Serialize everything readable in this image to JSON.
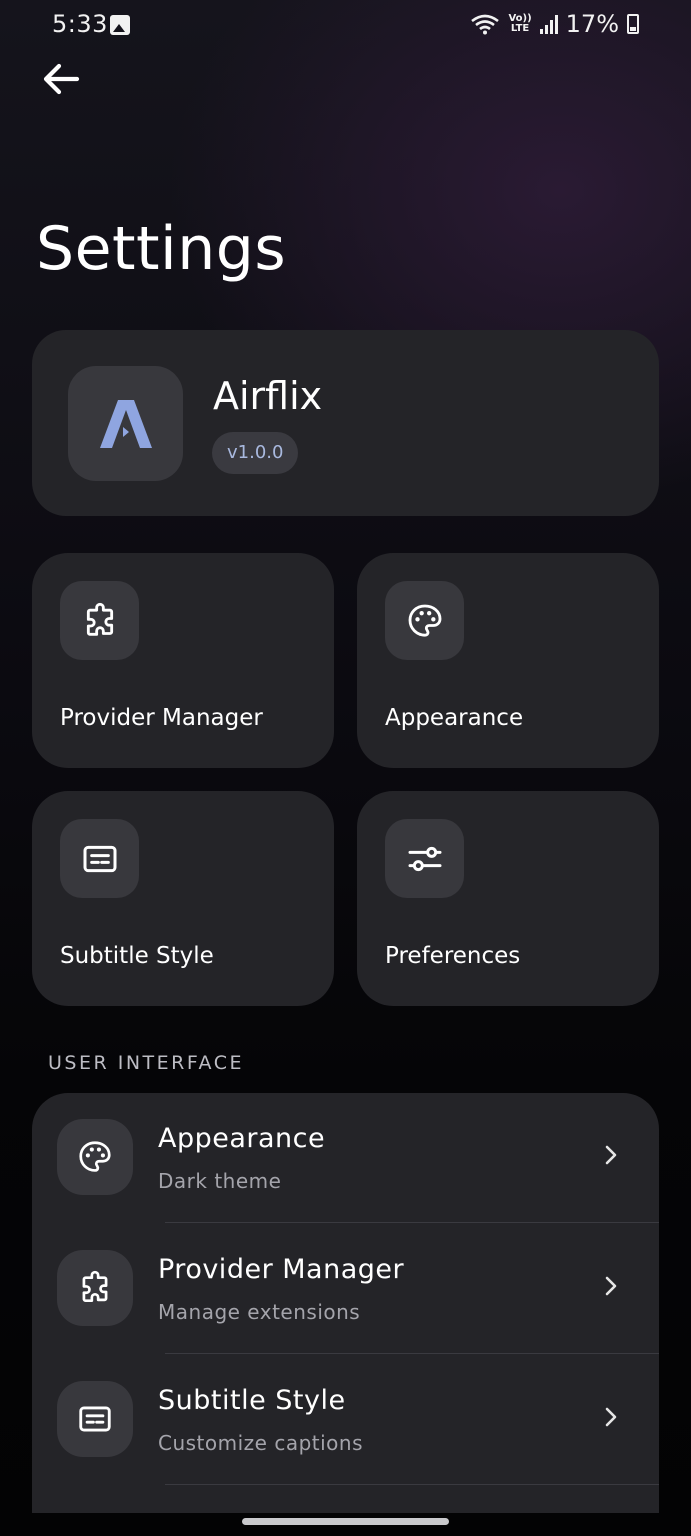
{
  "status_bar": {
    "time": "5:33",
    "volte_top": "Vo))",
    "volte_bottom": "LTE",
    "battery": "17%"
  },
  "header": {
    "title": "Settings"
  },
  "app_card": {
    "name": "Airflix",
    "version": "v1.0.0",
    "logo_letter": "A"
  },
  "tiles": [
    {
      "label": "Provider Manager",
      "icon": "puzzle-icon"
    },
    {
      "label": "Appearance",
      "icon": "palette-icon"
    },
    {
      "label": "Subtitle Style",
      "icon": "subtitles-icon"
    },
    {
      "label": "Preferences",
      "icon": "sliders-icon"
    }
  ],
  "section": {
    "header": "USER INTERFACE"
  },
  "list": [
    {
      "title": "Appearance",
      "subtitle": "Dark theme",
      "icon": "palette-icon"
    },
    {
      "title": "Provider Manager",
      "subtitle": "Manage extensions",
      "icon": "puzzle-icon"
    },
    {
      "title": "Subtitle Style",
      "subtitle": "Customize captions",
      "icon": "subtitles-icon"
    }
  ],
  "colors": {
    "card": "#242428",
    "icon_bg": "#38383d",
    "logo_accent": "#8fa5e0",
    "version_text": "#a9b9df"
  }
}
